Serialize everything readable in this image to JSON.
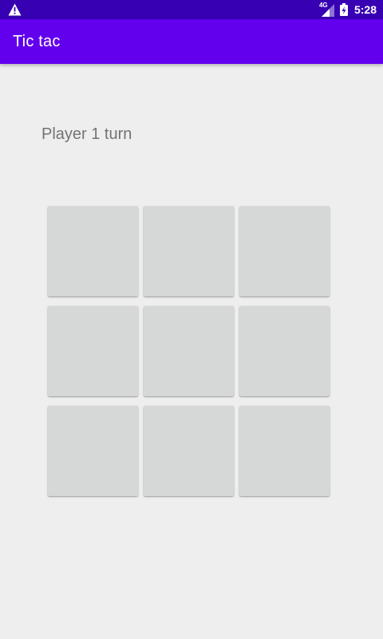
{
  "status_bar": {
    "network_type": "4G",
    "time": "5:28",
    "icons": [
      "warning-icon",
      "signal-icon",
      "battery-charging-icon"
    ]
  },
  "app_bar": {
    "title": "Tic tac"
  },
  "game": {
    "turn_text": "Player 1 turn",
    "board": [
      [
        "",
        "",
        ""
      ],
      [
        "",
        "",
        ""
      ],
      [
        "",
        "",
        ""
      ]
    ]
  },
  "colors": {
    "status_bar": "#3700b3",
    "app_bar": "#6200ee",
    "background": "#eeeeee",
    "cell": "#d6d7d7",
    "turn_text": "#737373"
  }
}
